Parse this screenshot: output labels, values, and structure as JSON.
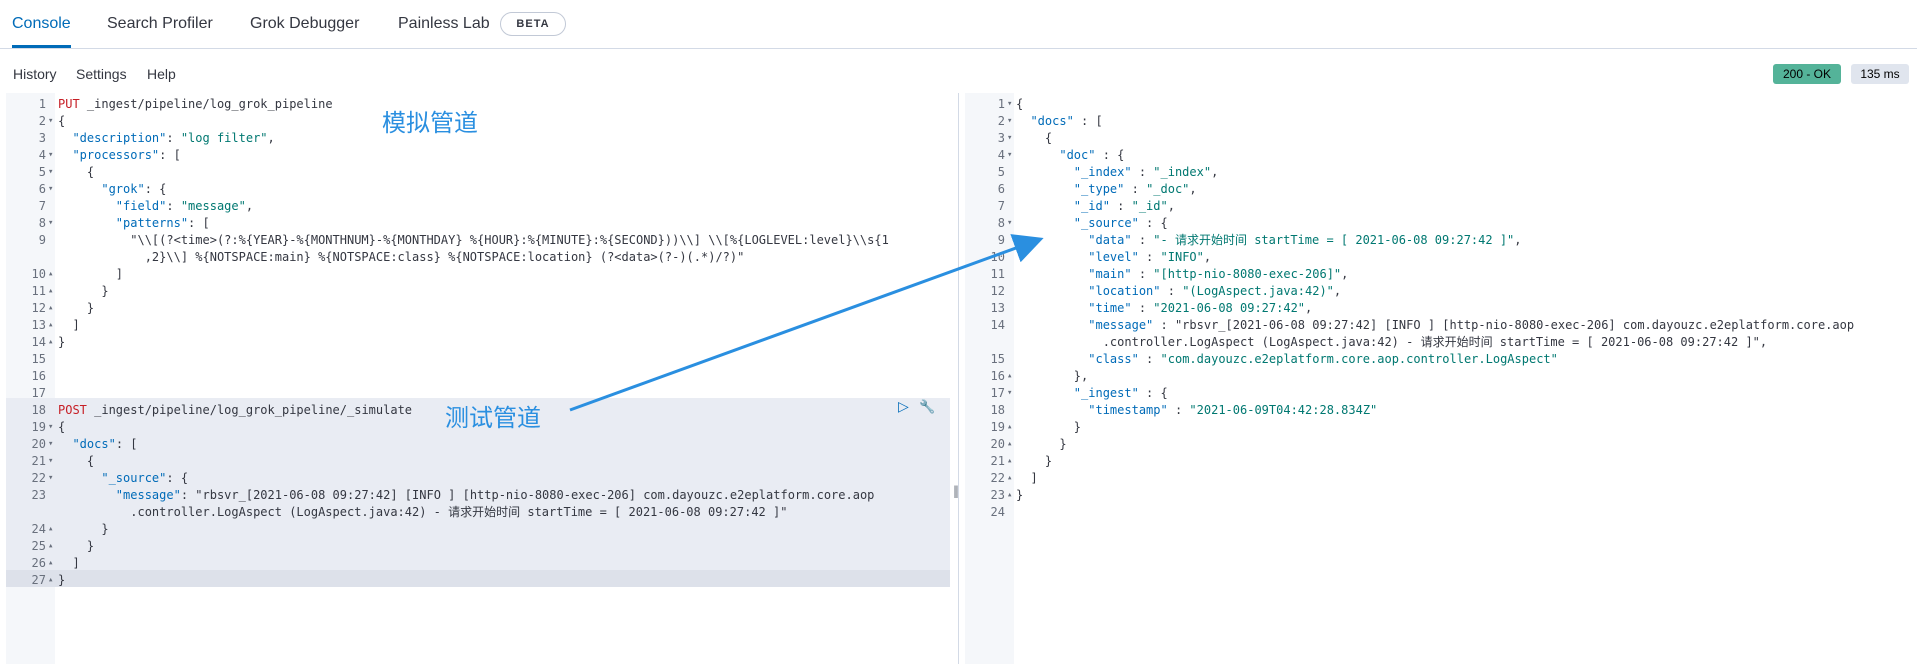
{
  "nav": {
    "tabs": [
      {
        "label": "Console",
        "active": true
      },
      {
        "label": "Search Profiler",
        "active": false
      },
      {
        "label": "Grok Debugger",
        "active": false
      },
      {
        "label": "Painless Lab",
        "active": false
      }
    ],
    "beta_badge": "BETA"
  },
  "toolbar": {
    "history": "History",
    "settings": "Settings",
    "help": "Help"
  },
  "response": {
    "status": "200 - OK",
    "time": "135 ms"
  },
  "annotations": {
    "pipeline_label": "模拟管道",
    "simulate_label": "测试管道"
  },
  "splitter_glyph": "‖",
  "actions": {
    "run_icon": "▷",
    "wrench_icon": "🔧"
  },
  "request_lines": [
    {
      "n": "1",
      "fold": "",
      "text": "PUT _ingest/pipeline/log_grok_pipeline"
    },
    {
      "n": "2",
      "fold": "▾",
      "text": "{"
    },
    {
      "n": "3",
      "fold": "",
      "text": "  \"description\": \"log filter\","
    },
    {
      "n": "4",
      "fold": "▾",
      "text": "  \"processors\": ["
    },
    {
      "n": "5",
      "fold": "▾",
      "text": "    {"
    },
    {
      "n": "6",
      "fold": "▾",
      "text": "      \"grok\": {"
    },
    {
      "n": "7",
      "fold": "",
      "text": "        \"field\": \"message\","
    },
    {
      "n": "8",
      "fold": "▾",
      "text": "        \"patterns\": ["
    },
    {
      "n": "9",
      "fold": "",
      "text": "          \"\\\\[(?<time>(?:%{YEAR}-%{MONTHNUM}-%{MONTHDAY} %{HOUR}:%{MINUTE}:%{SECOND}))\\\\] \\\\[%{LOGLEVEL:level}\\\\s{1"
    },
    {
      "n": "",
      "fold": "",
      "text": "            ,2}\\\\] %{NOTSPACE:main} %{NOTSPACE:class} %{NOTSPACE:location} (?<data>(?-)(.*)/?)\""
    },
    {
      "n": "10",
      "fold": "▴",
      "text": "        ]"
    },
    {
      "n": "11",
      "fold": "▴",
      "text": "      }"
    },
    {
      "n": "12",
      "fold": "▴",
      "text": "    }"
    },
    {
      "n": "13",
      "fold": "▴",
      "text": "  ]"
    },
    {
      "n": "14",
      "fold": "▴",
      "text": "}"
    },
    {
      "n": "15",
      "fold": "",
      "text": ""
    },
    {
      "n": "16",
      "fold": "",
      "text": ""
    },
    {
      "n": "17",
      "fold": "",
      "text": ""
    },
    {
      "n": "18",
      "fold": "",
      "text": "POST _ingest/pipeline/log_grok_pipeline/_simulate"
    },
    {
      "n": "19",
      "fold": "▾",
      "text": "{"
    },
    {
      "n": "20",
      "fold": "▾",
      "text": "  \"docs\": ["
    },
    {
      "n": "21",
      "fold": "▾",
      "text": "    {"
    },
    {
      "n": "22",
      "fold": "▾",
      "text": "      \"_source\": {"
    },
    {
      "n": "23",
      "fold": "",
      "text": "        \"message\": \"rbsvr_[2021-06-08 09:27:42] [INFO ] [http-nio-8080-exec-206] com.dayouzc.e2eplatform.core.aop"
    },
    {
      "n": "",
      "fold": "",
      "text": "          .controller.LogAspect (LogAspect.java:42) - 请求开始时间 startTime = [ 2021-06-08 09:27:42 ]\""
    },
    {
      "n": "24",
      "fold": "▴",
      "text": "      }"
    },
    {
      "n": "25",
      "fold": "▴",
      "text": "    }"
    },
    {
      "n": "26",
      "fold": "▴",
      "text": "  ]"
    },
    {
      "n": "27",
      "fold": "▴",
      "text": "}"
    }
  ],
  "response_lines": [
    {
      "n": "1",
      "fold": "▾",
      "text": "{"
    },
    {
      "n": "2",
      "fold": "▾",
      "text": "  \"docs\" : ["
    },
    {
      "n": "3",
      "fold": "▾",
      "text": "    {"
    },
    {
      "n": "4",
      "fold": "▾",
      "text": "      \"doc\" : {"
    },
    {
      "n": "5",
      "fold": "",
      "text": "        \"_index\" : \"_index\","
    },
    {
      "n": "6",
      "fold": "",
      "text": "        \"_type\" : \"_doc\","
    },
    {
      "n": "7",
      "fold": "",
      "text": "        \"_id\" : \"_id\","
    },
    {
      "n": "8",
      "fold": "▾",
      "text": "        \"_source\" : {"
    },
    {
      "n": "9",
      "fold": "",
      "text": "          \"data\" : \"- 请求开始时间 startTime = [ 2021-06-08 09:27:42 ]\","
    },
    {
      "n": "10",
      "fold": "",
      "text": "          \"level\" : \"INFO\","
    },
    {
      "n": "11",
      "fold": "",
      "text": "          \"main\" : \"[http-nio-8080-exec-206]\","
    },
    {
      "n": "12",
      "fold": "",
      "text": "          \"location\" : \"(LogAspect.java:42)\","
    },
    {
      "n": "13",
      "fold": "",
      "text": "          \"time\" : \"2021-06-08 09:27:42\","
    },
    {
      "n": "14",
      "fold": "",
      "text": "          \"message\" : \"rbsvr_[2021-06-08 09:27:42] [INFO ] [http-nio-8080-exec-206] com.dayouzc.e2eplatform.core.aop"
    },
    {
      "n": "",
      "fold": "",
      "text": "            .controller.LogAspect (LogAspect.java:42) - 请求开始时间 startTime = [ 2021-06-08 09:27:42 ]\","
    },
    {
      "n": "15",
      "fold": "",
      "text": "          \"class\" : \"com.dayouzc.e2eplatform.core.aop.controller.LogAspect\""
    },
    {
      "n": "16",
      "fold": "▴",
      "text": "        },"
    },
    {
      "n": "17",
      "fold": "▾",
      "text": "        \"_ingest\" : {"
    },
    {
      "n": "18",
      "fold": "",
      "text": "          \"timestamp\" : \"2021-06-09T04:42:28.834Z\""
    },
    {
      "n": "19",
      "fold": "▴",
      "text": "        }"
    },
    {
      "n": "20",
      "fold": "▴",
      "text": "      }"
    },
    {
      "n": "21",
      "fold": "▴",
      "text": "    }"
    },
    {
      "n": "22",
      "fold": "▴",
      "text": "  ]"
    },
    {
      "n": "23",
      "fold": "▴",
      "text": "}"
    },
    {
      "n": "24",
      "fold": "",
      "text": ""
    }
  ]
}
